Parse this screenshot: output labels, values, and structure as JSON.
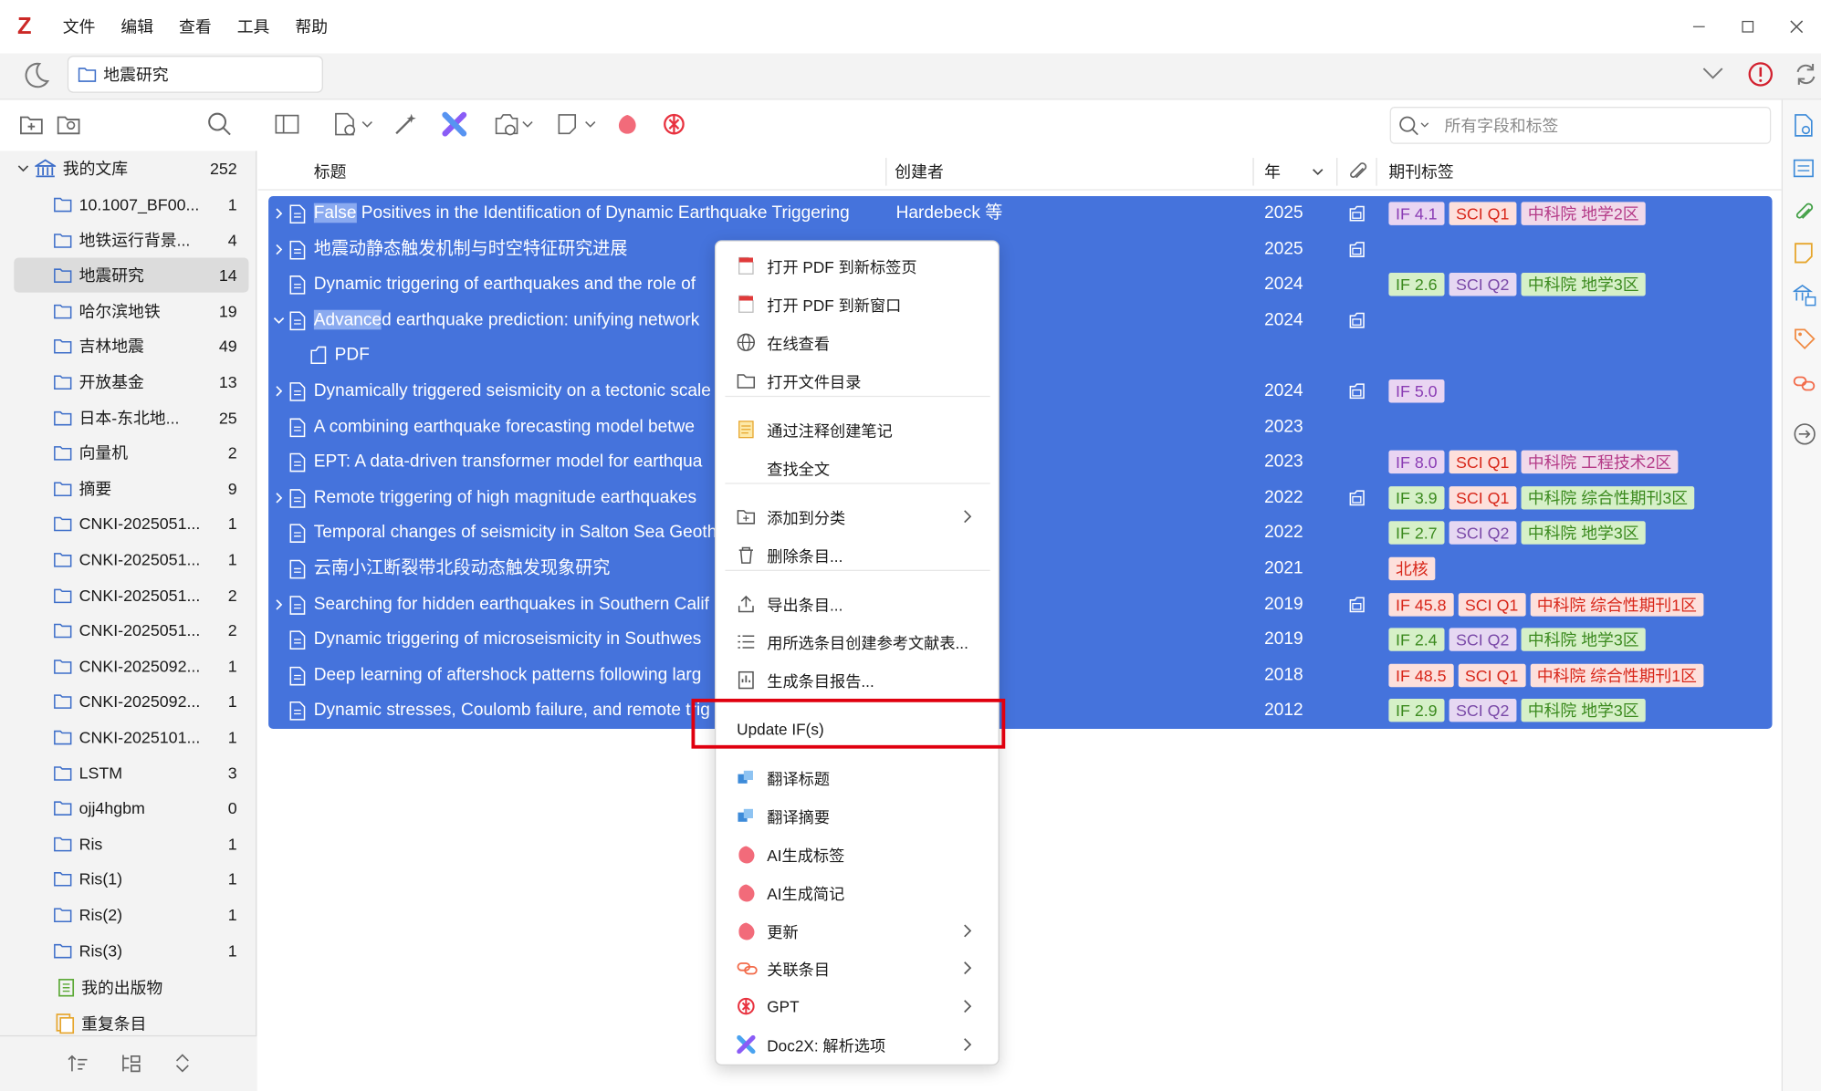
{
  "app": {
    "logo": "Z"
  },
  "menubar": [
    "文件",
    "编辑",
    "查看",
    "工具",
    "帮助"
  ],
  "location": {
    "tab_label": "地震研究"
  },
  "search": {
    "placeholder": "所有字段和标签"
  },
  "sidebar": {
    "library": {
      "name": "我的文库",
      "count": "252"
    },
    "collections": [
      {
        "name": "10.1007_BF00...",
        "count": "1"
      },
      {
        "name": "地铁运行背景...",
        "count": "4"
      },
      {
        "name": "地震研究",
        "count": "14"
      },
      {
        "name": "哈尔滨地铁",
        "count": "19"
      },
      {
        "name": "吉林地震",
        "count": "49"
      },
      {
        "name": "开放基金",
        "count": "13"
      },
      {
        "name": "日本-东北地...",
        "count": "25"
      },
      {
        "name": "向量机",
        "count": "2"
      },
      {
        "name": "摘要",
        "count": "9"
      },
      {
        "name": "CNKI-2025051...",
        "count": "1"
      },
      {
        "name": "CNKI-2025051...",
        "count": "1"
      },
      {
        "name": "CNKI-2025051...",
        "count": "2"
      },
      {
        "name": "CNKI-2025051...",
        "count": "2"
      },
      {
        "name": "CNKI-2025092...",
        "count": "1"
      },
      {
        "name": "CNKI-2025092...",
        "count": "1"
      },
      {
        "name": "CNKI-2025101...",
        "count": "1"
      },
      {
        "name": "LSTM",
        "count": "3"
      },
      {
        "name": "ojj4hgbm",
        "count": "0"
      },
      {
        "name": "Ris",
        "count": "1"
      },
      {
        "name": "Ris(1)",
        "count": "1"
      },
      {
        "name": "Ris(2)",
        "count": "1"
      },
      {
        "name": "Ris(3)",
        "count": "1"
      }
    ],
    "publications": "我的出版物",
    "duplicates": "重复条目"
  },
  "columns": {
    "title": "标题",
    "creator": "创建者",
    "year": "年",
    "journal_tags": "期刊标签"
  },
  "items": [
    {
      "hl": "False",
      "title": " Positives in the Identification of Dynamic Earthquake Triggering",
      "creator": "Hardebeck 等",
      "year": "2025",
      "attach": true,
      "expand": ">",
      "tags": [
        [
          "IF 4.1",
          "if"
        ],
        [
          "SCI Q1",
          "q1"
        ],
        [
          "中科院 地学2区",
          "cas"
        ]
      ]
    },
    {
      "hl": "",
      "title": "地震动静态触发机制与时空特征研究进展",
      "creator": "",
      "year": "2025",
      "attach": true,
      "expand": ">",
      "tags": []
    },
    {
      "hl": "",
      "title": "Dynamic triggering of earthquakes and the role of",
      "creator": "",
      "year": "2024",
      "attach": false,
      "expand": "",
      "tags": [
        [
          "IF 2.6",
          "ifg"
        ],
        [
          "SCI Q2",
          "q2"
        ],
        [
          "中科院 地学3区",
          "casg"
        ]
      ]
    },
    {
      "hl": "Advance",
      "title": "d earthquake prediction: unifying network",
      "creator": "",
      "year": "2024",
      "attach": true,
      "expand": "v",
      "tags": []
    },
    {
      "hl": "",
      "title": "PDF",
      "creator": "",
      "year": "",
      "attach": false,
      "expand": "",
      "child": true,
      "tags": []
    },
    {
      "hl": "",
      "title": "Dynamically triggered seismicity on a tectonic scale",
      "creator": "",
      "year": "2024",
      "attach": true,
      "expand": ">",
      "tags": [
        [
          "IF 5.0",
          "if"
        ]
      ]
    },
    {
      "hl": "",
      "title": "A combining earthquake forecasting model betwe",
      "creator": "",
      "year": "2023",
      "attach": false,
      "expand": "",
      "tags": []
    },
    {
      "hl": "",
      "title": "EPT: A data-driven transformer model for earthqua",
      "creator": "",
      "year": "2023",
      "attach": false,
      "expand": "",
      "tags": [
        [
          "IF 8.0",
          "if"
        ],
        [
          "SCI Q1",
          "q1"
        ],
        [
          "中科院 工程技术2区",
          "cas"
        ]
      ]
    },
    {
      "hl": "",
      "title": "Remote triggering of high magnitude earthquakes",
      "creator": "",
      "year": "2022",
      "attach": true,
      "expand": ">",
      "tags": [
        [
          "IF 3.9",
          "ifg"
        ],
        [
          "SCI Q1",
          "q1"
        ],
        [
          "中科院 综合性期刊3区",
          "casg"
        ]
      ]
    },
    {
      "hl": "",
      "title": "Temporal changes of seismicity in Salton Sea Geoth",
      "creator": "",
      "year": "2022",
      "attach": false,
      "expand": "",
      "tags": [
        [
          "IF 2.7",
          "ifg"
        ],
        [
          "SCI Q2",
          "q2"
        ],
        [
          "中科院 地学3区",
          "casg"
        ]
      ]
    },
    {
      "hl": "",
      "title": "云南小江断裂带北段动态触发现象研究",
      "creator": "",
      "year": "2021",
      "attach": false,
      "expand": "",
      "tags": [
        [
          "北核",
          "q1"
        ]
      ]
    },
    {
      "hl": "",
      "title": "Searching for hidden earthquakes in Southern Calif",
      "creator": "",
      "year": "2019",
      "attach": true,
      "expand": ">",
      "tags": [
        [
          "IF 45.8",
          "ifr"
        ],
        [
          "SCI Q1",
          "q1r"
        ],
        [
          "中科院 综合性期刊1区",
          "casr"
        ]
      ]
    },
    {
      "hl": "",
      "title": "Dynamic triggering of microseismicity in Southwes",
      "creator": "",
      "year": "2019",
      "attach": false,
      "expand": "",
      "tags": [
        [
          "IF 2.4",
          "ifg"
        ],
        [
          "SCI Q2",
          "q2"
        ],
        [
          "中科院 地学3区",
          "casg"
        ]
      ]
    },
    {
      "hl": "",
      "title": "Deep learning of aftershock patterns following larg",
      "creator": "",
      "year": "2018",
      "attach": false,
      "expand": "",
      "tags": [
        [
          "IF 48.5",
          "ifr"
        ],
        [
          "SCI Q1",
          "q1r"
        ],
        [
          "中科院 综合性期刊1区",
          "casr"
        ]
      ]
    },
    {
      "hl": "",
      "title": "Dynamic stresses, Coulomb failure, and remote trig",
      "creator": "",
      "year": "2012",
      "attach": false,
      "expand": "",
      "tags": [
        [
          "IF 2.9",
          "ifg"
        ],
        [
          "SCI Q2",
          "q2"
        ],
        [
          "中科院 地学3区",
          "casg"
        ]
      ]
    }
  ],
  "context_menu": {
    "items": [
      {
        "label": "打开 PDF 到新标签页",
        "icon": "pdf-icon"
      },
      {
        "label": "打开 PDF 到新窗口",
        "icon": "pdf-icon"
      },
      {
        "label": "在线查看",
        "icon": "globe-icon"
      },
      {
        "label": "打开文件目录",
        "icon": "folder-icon"
      },
      {
        "sep": true
      },
      {
        "label": "通过注释创建笔记",
        "icon": "note-icon"
      },
      {
        "label": "查找全文",
        "icon": ""
      },
      {
        "sep": true
      },
      {
        "label": "添加到分类",
        "icon": "folder-add-icon",
        "sub": true
      },
      {
        "label": "删除条目...",
        "icon": "trash-icon"
      },
      {
        "sep": true
      },
      {
        "label": "导出条目...",
        "icon": "export-icon"
      },
      {
        "label": "用所选条目创建参考文献表...",
        "icon": "list-icon"
      },
      {
        "label": "生成条目报告...",
        "icon": "report-icon"
      },
      {
        "label": "Update IF(s)",
        "icon": "",
        "highlight": true
      },
      {
        "sep": true
      },
      {
        "label": "翻译标题",
        "icon": "translate-icon"
      },
      {
        "label": "翻译摘要",
        "icon": "translate-icon"
      },
      {
        "label": "AI生成标签",
        "icon": "ai-icon"
      },
      {
        "label": "AI生成简记",
        "icon": "ai-icon"
      },
      {
        "label": "更新",
        "icon": "ai-icon",
        "sub": true
      },
      {
        "label": "关联条目",
        "icon": "link-icon",
        "sub": true
      },
      {
        "label": "GPT",
        "icon": "gpt-icon",
        "sub": true
      },
      {
        "label": "Doc2X: 解析选项",
        "icon": "doc2x-icon",
        "sub": true
      }
    ]
  },
  "colors": {
    "selection": "#4573dc",
    "highlight_box": "#e0000f",
    "accent_red": "#cc2927"
  }
}
